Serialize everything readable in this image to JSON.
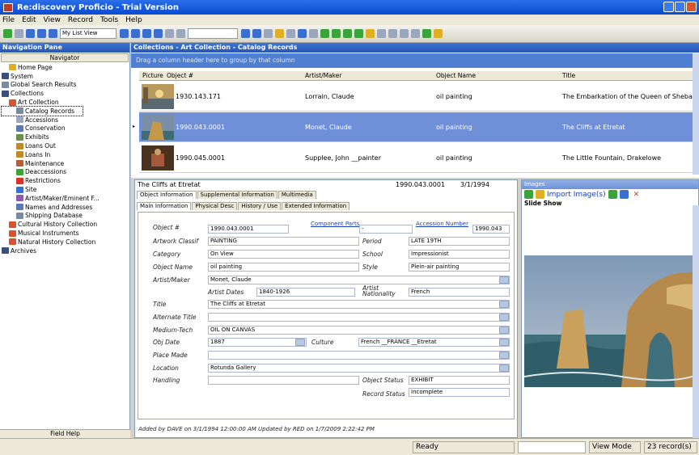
{
  "window": {
    "title": "Re:discovery Proficio - Trial Version"
  },
  "menu": [
    "File",
    "Edit",
    "View",
    "Record",
    "Tools",
    "Help"
  ],
  "toolbar": {
    "view_select": "My List View"
  },
  "nav": {
    "title": "Navigation Pane",
    "navigator": "Navigator",
    "items": [
      {
        "label": "Home Page",
        "level": 1,
        "icon": "home-icon",
        "color": "#e0b024"
      },
      {
        "label": "System",
        "level": 0,
        "icon": "re-icon",
        "color": "#3b4f7a"
      },
      {
        "label": "Global Search Results",
        "level": 0,
        "icon": "search-results-icon",
        "color": "#7a8aa0"
      },
      {
        "label": "Collections",
        "level": 0,
        "icon": "re-icon",
        "color": "#3b4f7a"
      },
      {
        "label": "Art Collection",
        "level": 1,
        "icon": "art-icon",
        "color": "#d9532c"
      },
      {
        "label": "Catalog Records",
        "level": 2,
        "icon": "catalog-icon",
        "color": "#7a8aa0",
        "selected": true
      },
      {
        "label": "Accessions",
        "level": 2,
        "icon": "accessions-icon",
        "color": "#9aa7bc"
      },
      {
        "label": "Conservation",
        "level": 2,
        "icon": "conservation-icon",
        "color": "#5b7ab0"
      },
      {
        "label": "Exhibits",
        "level": 2,
        "icon": "exhibits-icon",
        "color": "#6b8e4e"
      },
      {
        "label": "Loans Out",
        "level": 2,
        "icon": "loans-out-icon",
        "color": "#c08a2a"
      },
      {
        "label": "Loans In",
        "level": 2,
        "icon": "loans-in-icon",
        "color": "#c08a2a"
      },
      {
        "label": "Maintenance",
        "level": 2,
        "icon": "maintenance-icon",
        "color": "#b0603a"
      },
      {
        "label": "Deaccessions",
        "level": 2,
        "icon": "deaccessions-icon",
        "color": "#3aa33a"
      },
      {
        "label": "Restrictions",
        "level": 2,
        "icon": "restrictions-icon",
        "color": "#d9342c"
      },
      {
        "label": "Site",
        "level": 2,
        "icon": "site-icon",
        "color": "#3b6fcf"
      },
      {
        "label": "Artist/Maker/Eminent F...",
        "level": 2,
        "icon": "artist-icon",
        "color": "#8e5ab0"
      },
      {
        "label": "Names and Addresses",
        "level": 2,
        "icon": "names-icon",
        "color": "#5b7ab0"
      },
      {
        "label": "Shipping Database",
        "level": 2,
        "icon": "shipping-icon",
        "color": "#7a8aa0"
      },
      {
        "label": "Cultural History Collection",
        "level": 1,
        "icon": "cultural-icon",
        "color": "#d9532c"
      },
      {
        "label": "Musical Instruments",
        "level": 1,
        "icon": "music-icon",
        "color": "#d9532c"
      },
      {
        "label": "Natural History Collection",
        "level": 1,
        "icon": "natural-icon",
        "color": "#d9532c"
      },
      {
        "label": "Archives",
        "level": 0,
        "icon": "re-icon",
        "color": "#3b4f7a"
      }
    ],
    "field_help": "Field Help"
  },
  "grid": {
    "title": "Collections - Art Collection - Catalog Records",
    "group_hint": "Drag a column header here to group by that column",
    "columns": [
      "Picture",
      "Object #",
      "Artist/Maker",
      "Object Name",
      "Title"
    ],
    "rows": [
      {
        "object": "1930.143.171",
        "artist": "Lorrain, Claude",
        "name": "oil painting",
        "title": "The Embarkation of the Queen of Sheba"
      },
      {
        "object": "1990.043.0001",
        "artist": "Monet, Claude",
        "name": "oil painting",
        "title": "The Cliffs at Etretat",
        "selected": true
      },
      {
        "object": "1990.045.0001",
        "artist": "Supplee, John __painter",
        "name": "oil painting",
        "title": "The Little Fountain, Drakelowe"
      }
    ]
  },
  "detail": {
    "title": "The Cliffs at Etretat",
    "object_no": "1990.043.0001",
    "date": "3/1/1994",
    "tabs": [
      "Object Information",
      "Supplemental Information",
      "Multimedia"
    ],
    "subtabs": [
      "Main Information",
      "Physical Desc",
      "History / Use",
      "Extended Information"
    ],
    "labels": {
      "object": "Object #",
      "artwork": "Artwork Classif",
      "category": "Category",
      "objname": "Object Name",
      "artist": "Artist/Maker",
      "dates": "Artist Dates",
      "nationality": "Artist Nationality",
      "title": "Title",
      "alttitle": "Alternate Title",
      "medium": "Medium-Tech",
      "objdate": "Obj Date",
      "culture": "Culture",
      "placemade": "Place Made",
      "location": "Location",
      "handling": "Handling",
      "period": "Period",
      "school": "School",
      "style": "Style",
      "status": "Object Status",
      "recstatus": "Record Status"
    },
    "values": {
      "object": "1990.043.0001",
      "component_link": "Component Parts",
      "component": "-",
      "accession_link": "Accession Number",
      "accession": "1990.043",
      "artwork": "PAINTING",
      "category": "On View",
      "objname": "oil painting",
      "artist": "Monet, Claude",
      "dates": "1840-1926",
      "nationality": "French",
      "title": "The Cliffs at Etretat",
      "alttitle": "",
      "medium": "OIL ON CANVAS",
      "objdate": "1887",
      "culture": "French __FRANCE __Etretat",
      "placemade": "",
      "location": "Rotunda Gallery",
      "handling": "",
      "period": "LATE 19TH",
      "school": "Impressionist",
      "style": "Plein-air painting",
      "status": "EXHIBIT",
      "recstatus": "Incomplete"
    },
    "audit": "Added by DAVE on 3/1/1994 12:00:00 AM   Updated by RED on 1/7/2009 2:22:42 PM"
  },
  "images": {
    "title": "Images",
    "import": "Import Image(s)",
    "slideshow": "Slide Show"
  },
  "status": {
    "ready": "Ready",
    "mode": "View Mode",
    "count": "23 record(s)"
  },
  "colors": {
    "titlebar": "#0a4bd0",
    "selected_row": "#6f8fd8",
    "group_hint": "#4f7fd0"
  }
}
